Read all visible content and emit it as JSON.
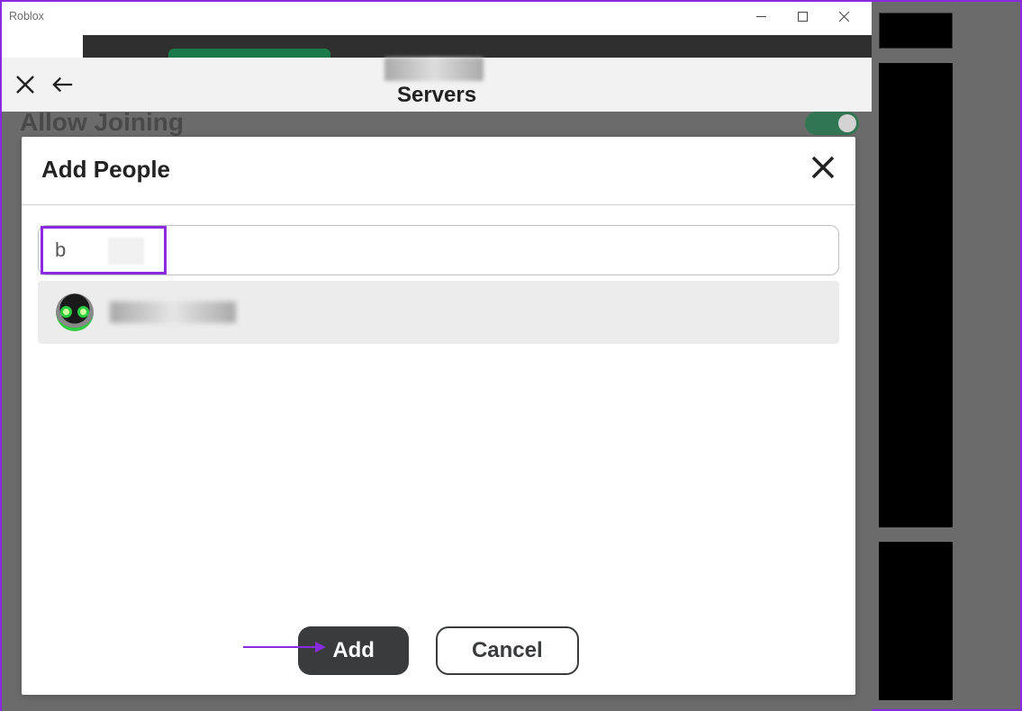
{
  "window": {
    "title": "Roblox"
  },
  "subheader": {
    "title": "Servers"
  },
  "allow_joining_label": "Allow Joining",
  "toggle_on": true,
  "modal": {
    "title": "Add People",
    "search_value": "b",
    "search_placeholder": "",
    "result_name": "",
    "add_label": "Add",
    "cancel_label": "Cancel"
  }
}
